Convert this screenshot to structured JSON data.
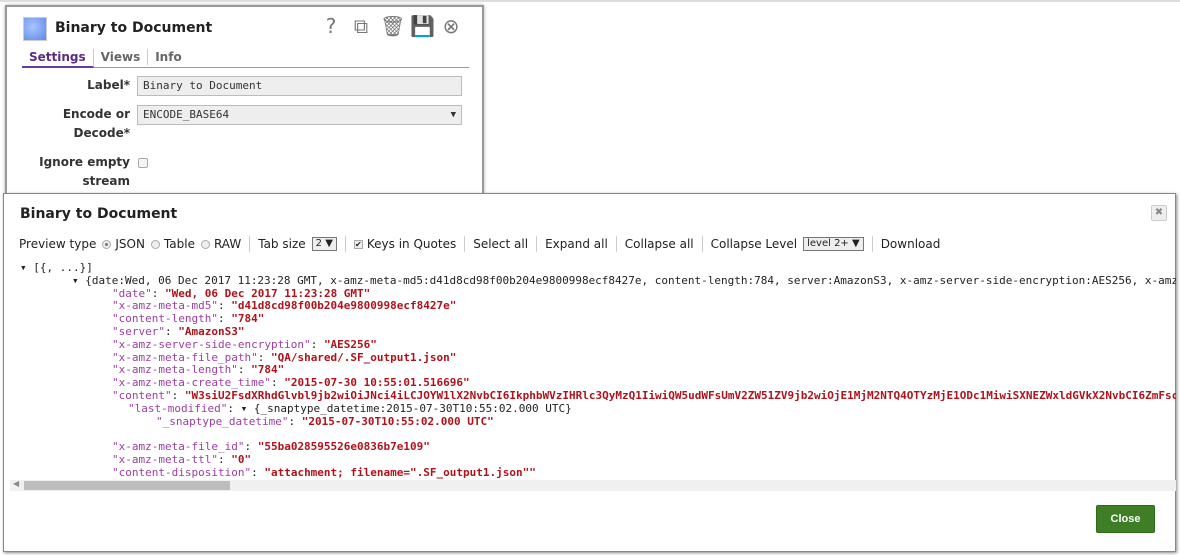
{
  "settings_panel": {
    "title": "Binary to Document",
    "icons": [
      "help-icon",
      "export-icon",
      "trash-icon",
      "save-icon",
      "close-circle-icon"
    ],
    "tabs": [
      {
        "label": "Settings",
        "active": true
      },
      {
        "label": "Views"
      },
      {
        "label": "Info"
      }
    ],
    "fields": {
      "label_label": "Label*",
      "label_value": "Binary to Document",
      "encode_label_1": "Encode or",
      "encode_label_2": "Decode*",
      "encode_value": "ENCODE_BASE64",
      "ignore_label_1": "Ignore empty",
      "ignore_label_2": "stream",
      "ignore_checked": false
    }
  },
  "preview": {
    "title": "Binary to Document",
    "toolbar": {
      "preview_type": "Preview type",
      "json": "JSON",
      "table": "Table",
      "raw": "RAW",
      "selected": "JSON",
      "tab_size_label": "Tab size",
      "tab_size": "2",
      "keys_in_quotes": "Keys in Quotes",
      "keys_in_quotes_checked": true,
      "select_all": "Select all",
      "expand_all": "Expand all",
      "collapse_all": "Collapse all",
      "collapse_level_label": "Collapse Level",
      "collapse_level": "level 2+",
      "download": "Download"
    },
    "root": "[{, ...}]",
    "summary": "{date:Wed, 06 Dec 2017 11:23:28 GMT, x-amz-meta-md5:d41d8cd98f00b204e9800998ecf8427e, content-length:784, server:AmazonS3, x-amz-server-side-encryption:AES256, x-amz",
    "entries": [
      {
        "key": "\"date\"",
        "value": "\"Wed, 06 Dec 2017 11:23:28 GMT\""
      },
      {
        "key": "\"x-amz-meta-md5\"",
        "value": "\"d41d8cd98f00b204e9800998ecf8427e\""
      },
      {
        "key": "\"content-length\"",
        "value": "\"784\""
      },
      {
        "key": "\"server\"",
        "value": "\"AmazonS3\""
      },
      {
        "key": "\"x-amz-server-side-encryption\"",
        "value": "\"AES256\""
      },
      {
        "key": "\"x-amz-meta-file_path\"",
        "value": "\"QA/shared/.SF_output1.json\""
      },
      {
        "key": "\"x-amz-meta-length\"",
        "value": "\"784\""
      },
      {
        "key": "\"x-amz-meta-create_time\"",
        "value": "\"2015-07-30 10:55:01.516696\""
      },
      {
        "key": "\"content\"",
        "value": "\"W3siU2FsdXRhdGlvbl9jb2wiOiJNci4iLCJOYW1lX2NvbCI6IkphbWVzIHRlc3QyMzQ1IiwiQW5udWFsUmV2ZW51ZV9jb2wiOjE1MjM2NTQ4OTYzMjE1ODc1MiwiSXNEZWxldGVkX2NvbCI6ZmFsc2"
      }
    ],
    "last_modified": {
      "key": "\"last-modified\"",
      "summary": "{_snaptype_datetime:2015-07-30T10:55:02.000 UTC}",
      "child_key": "\"_snaptype_datetime\"",
      "child_value": "\"2015-07-30T10:55:02.000 UTC\""
    },
    "entries_after": [
      {
        "key": "\"x-amz-meta-file_id\"",
        "value": "\"55ba028595526e0836b7e109\""
      },
      {
        "key": "\"x-amz-meta-ttl\"",
        "value": "\"0\""
      },
      {
        "key": "\"content-disposition\"",
        "value": "\"attachment; filename=\".SF_output1.json\"\""
      }
    ],
    "close_button": "Close",
    "colors": {
      "key": "#9b3ea4",
      "value": "#b0121b",
      "accent": "#5b2a86",
      "close_button": "#3e7f25"
    }
  }
}
